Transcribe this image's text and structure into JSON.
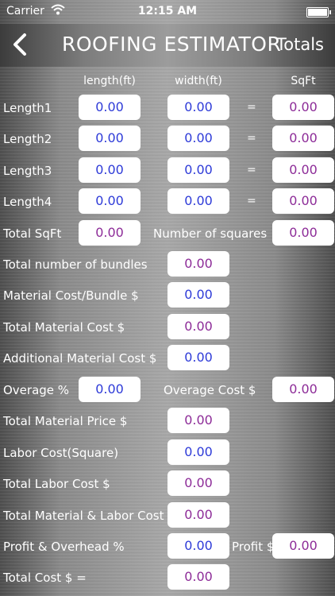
{
  "status_bar": {
    "carrier": "Carrier",
    "time": "12:15 AM"
  },
  "nav": {
    "back_icon": "chevron-left-icon",
    "title": "ROOFING ESTIMATOR",
    "right_label": "Totals"
  },
  "headers": {
    "length": "length(ft)",
    "width": "width(ft)",
    "sqft": "SqFt"
  },
  "length_rows": [
    {
      "label": "Length1",
      "length": "0.00",
      "width": "0.00",
      "eq": "=",
      "sqft": "0.00"
    },
    {
      "label": "Length2",
      "length": "0.00",
      "width": "0.00",
      "eq": "=",
      "sqft": "0.00"
    },
    {
      "label": "Length3",
      "length": "0.00",
      "width": "0.00",
      "eq": "=",
      "sqft": "0.00"
    },
    {
      "label": "Length4",
      "length": "0.00",
      "width": "0.00",
      "eq": "=",
      "sqft": "0.00"
    }
  ],
  "total_sqft": {
    "label": "Total SqFt",
    "value": "0.00",
    "squares_label": "Number of squares",
    "squares_value": "0.00"
  },
  "bundles": {
    "label": "Total number of bundles",
    "value": "0.00"
  },
  "material_cost_bundle": {
    "label": "Material Cost/Bundle $",
    "value": "0.00"
  },
  "total_material_cost": {
    "label": "Total Material Cost $",
    "value": "0.00"
  },
  "additional_material_cost": {
    "label": "Additional Material Cost $",
    "value": "0.00"
  },
  "overage": {
    "label": "Overage %",
    "value": "0.00",
    "cost_label": "Overage Cost $",
    "cost_value": "0.00"
  },
  "total_material_price": {
    "label": "Total Material Price $",
    "value": "0.00"
  },
  "labor_cost_square": {
    "label": "Labor Cost(Square)",
    "value": "0.00"
  },
  "total_labor_cost": {
    "label": "Total Labor Cost $",
    "value": "0.00"
  },
  "total_material_labor": {
    "label": "Total Material & Labor Cost $",
    "value": "0.00"
  },
  "profit_overhead": {
    "label": "Profit & Overhead %",
    "value": "0.00",
    "profit_label": "Profit $",
    "profit_value": "0.00"
  },
  "total_cost": {
    "label": "Total Cost $ =",
    "value": "0.00"
  },
  "colors": {
    "input_text": "#2e3bd8",
    "computed_text": "#8d2c98"
  }
}
